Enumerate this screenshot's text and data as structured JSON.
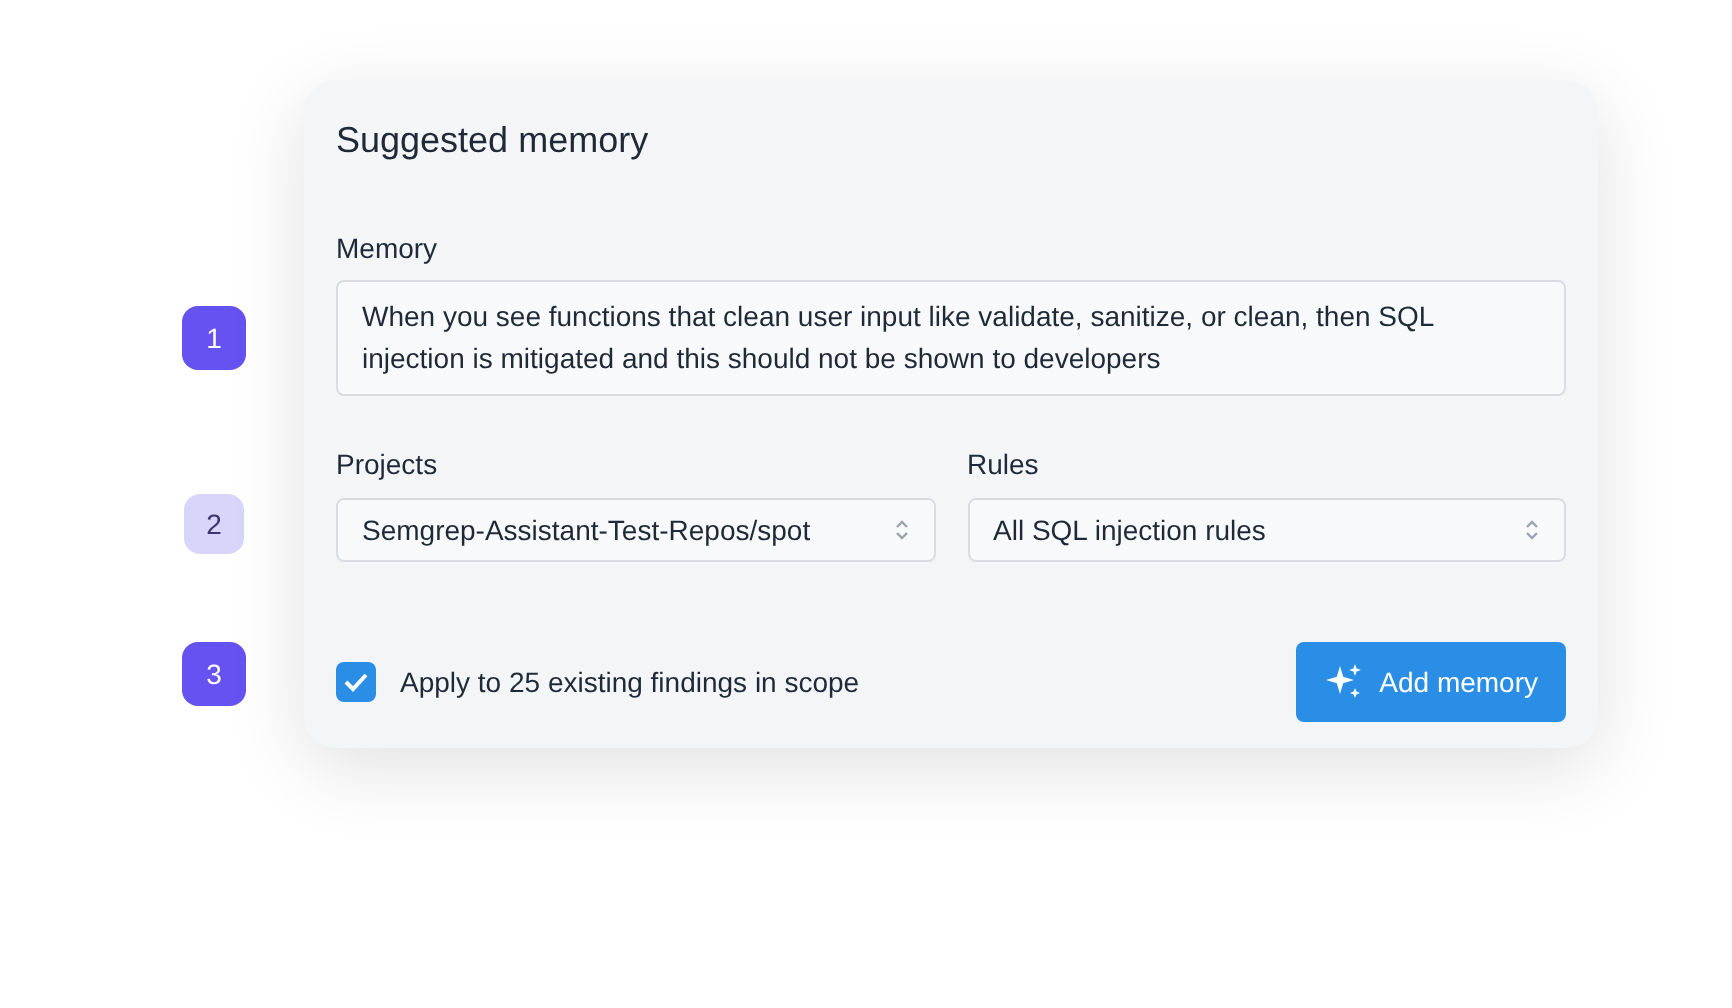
{
  "steps": [
    {
      "label": "1",
      "active": true
    },
    {
      "label": "2",
      "active": false
    },
    {
      "label": "3",
      "active": true
    }
  ],
  "card": {
    "title": "Suggested memory",
    "memory": {
      "label": "Memory",
      "value": "When you see functions that clean user input like validate, sanitize, or clean, then SQL injection is mitigated and this should not be shown to developers"
    },
    "projects": {
      "label": "Projects",
      "value": "Semgrep-Assistant-Test-Repos/spot"
    },
    "rules": {
      "label": "Rules",
      "value": "All SQL injection rules"
    },
    "apply": {
      "label": "Apply to 25 existing findings in scope",
      "checked": true
    },
    "button": "Add memory"
  }
}
